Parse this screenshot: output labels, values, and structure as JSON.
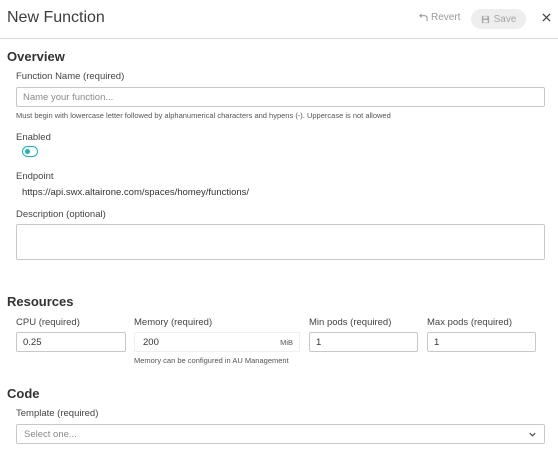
{
  "header": {
    "title": "New Function",
    "revert_label": "Revert",
    "save_label": "Save"
  },
  "overview": {
    "section_title": "Overview",
    "function_name": {
      "label": "Function Name (required)",
      "placeholder": "Name your function...",
      "value": "",
      "hint": "Must begin with lowercase letter followed by alphanumerical characters and hypens (-). Uppercase is not allowed"
    },
    "enabled": {
      "label": "Enabled",
      "state": true
    },
    "endpoint": {
      "label": "Endpoint",
      "value": "https://api.swx.altairone.com/spaces/homey/functions/"
    },
    "description": {
      "label": "Description (optional)",
      "value": ""
    }
  },
  "resources": {
    "section_title": "Resources",
    "cpu": {
      "label": "CPU (required)",
      "value": "0.25"
    },
    "memory": {
      "label": "Memory (required)",
      "value": "200",
      "unit": "MiB",
      "hint": "Memory can be configured in AU Management"
    },
    "min_pods": {
      "label": "Min pods (required)",
      "value": "1"
    },
    "max_pods": {
      "label": "Max pods (required)",
      "value": "1"
    }
  },
  "code": {
    "section_title": "Code",
    "template": {
      "label": "Template (required)",
      "placeholder": "Select one..."
    }
  },
  "colors": {
    "accent": "#19b5c0",
    "border": "#c8c8c8",
    "muted_text": "#9a9a9a"
  },
  "icons": {
    "revert": "undo-arrow-icon",
    "save": "floppy-disk-icon",
    "close": "close-icon",
    "select": "chevron-down-icon"
  }
}
